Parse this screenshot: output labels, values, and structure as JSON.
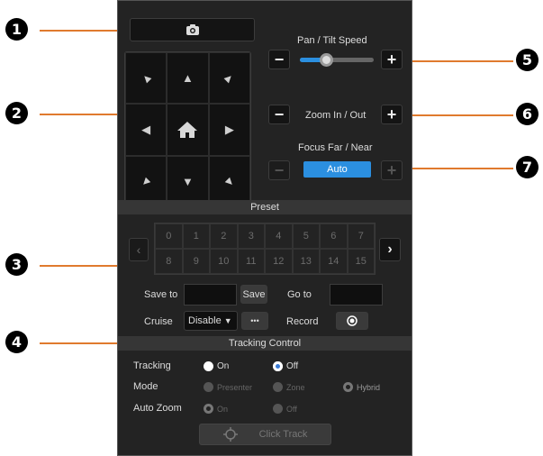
{
  "callouts": [
    "1",
    "2",
    "3",
    "4",
    "5",
    "6",
    "7"
  ],
  "colors": {
    "accent": "#2b8fe0",
    "leader": "#e07a2e",
    "panel": "#232323"
  },
  "icons": {
    "snapshot": "camera-icon",
    "home": "home-icon"
  },
  "ptz": {
    "pan_tilt_label": "Pan / Tilt Speed",
    "pan_tilt_speed": 0.35,
    "zoom_label": "Zoom In / Out",
    "focus_label": "Focus Far / Near",
    "focus_auto_label": "Auto",
    "minus": "−",
    "plus": "+"
  },
  "preset": {
    "title": "Preset",
    "numbers": [
      "0",
      "1",
      "2",
      "3",
      "4",
      "5",
      "6",
      "7",
      "8",
      "9",
      "10",
      "11",
      "12",
      "13",
      "14",
      "15"
    ],
    "save_to_label": "Save to",
    "save_button": "Save",
    "goto_label": "Go to",
    "cruise_label": "Cruise",
    "cruise_value": "Disable",
    "more_button": "•••",
    "record_label": "Record"
  },
  "tracking": {
    "title": "Tracking Control",
    "tracking_label": "Tracking",
    "on": "On",
    "off": "Off",
    "mode_label": "Mode",
    "presenter": "Presenter",
    "zone": "Zone",
    "hybrid": "Hybrid",
    "auto_zoom_label": "Auto Zoom",
    "zoom_on": "On",
    "zoom_off": "Off",
    "click_track": "Click Track"
  }
}
